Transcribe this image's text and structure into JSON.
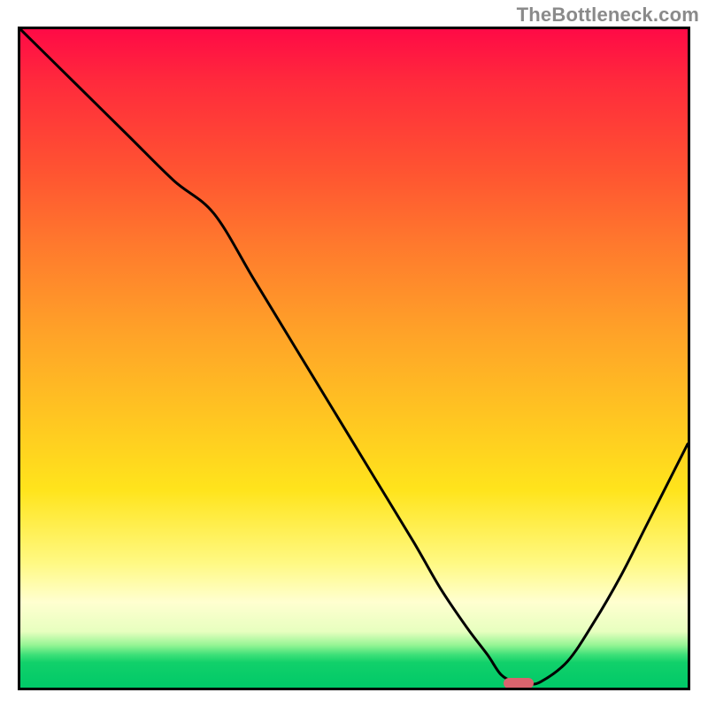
{
  "watermark": "TheBottleneck.com",
  "chart_data": {
    "type": "line",
    "title": "",
    "xlabel": "",
    "ylabel": "",
    "xlim": [
      0,
      100
    ],
    "ylim": [
      0,
      100
    ],
    "series": [
      {
        "name": "curve",
        "x": [
          0,
          8,
          16,
          23,
          29,
          35,
          41,
          47,
          53,
          59,
          63,
          67,
          70,
          72,
          74,
          76,
          78,
          82,
          86,
          90,
          94,
          98,
          100
        ],
        "y": [
          100,
          92,
          84,
          77,
          72,
          62,
          52,
          42,
          32,
          22,
          15,
          9,
          5,
          2,
          0.9,
          0.6,
          0.9,
          4,
          10,
          17,
          25,
          33,
          37
        ]
      }
    ],
    "marker": {
      "x": 74.7,
      "y": 0.7
    },
    "gradient_stops": [
      {
        "pos": 0,
        "color": "#ff0a46"
      },
      {
        "pos": 8,
        "color": "#ff2a3c"
      },
      {
        "pos": 22,
        "color": "#ff5531"
      },
      {
        "pos": 33,
        "color": "#ff7a2d"
      },
      {
        "pos": 46,
        "color": "#ffa228"
      },
      {
        "pos": 58,
        "color": "#ffc322"
      },
      {
        "pos": 70,
        "color": "#ffe41c"
      },
      {
        "pos": 81,
        "color": "#fff982"
      },
      {
        "pos": 87,
        "color": "#ffffd0"
      },
      {
        "pos": 91.5,
        "color": "#e7ffbf"
      },
      {
        "pos": 93.5,
        "color": "#97f595"
      },
      {
        "pos": 95,
        "color": "#3de078"
      },
      {
        "pos": 96.2,
        "color": "#11d06a"
      },
      {
        "pos": 100,
        "color": "#00c968"
      }
    ]
  }
}
